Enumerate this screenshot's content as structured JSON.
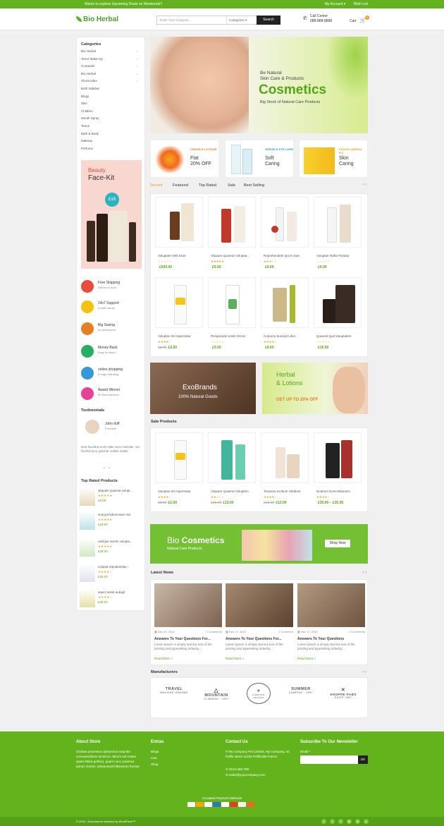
{
  "topbar": {
    "promo": "Wants to explore Upcoming Deals on Weekends?",
    "account": "My Account ▾",
    "wishlist": "Wish List"
  },
  "header": {
    "logo": "Bio Herbal",
    "search_placeholder": "Enter Your Keyword...",
    "search_category": "Categories",
    "search_button": "Search",
    "call_label": "Call Center",
    "call_number": "088-888-8888",
    "cart_label": "Cart",
    "cart_count": "0"
  },
  "sidebar": {
    "categories_title": "Categories",
    "categories": [
      {
        "label": "Bio Herbal",
        "arrow": "›"
      },
      {
        "label": "TenAl Make-Up",
        "arrow": "›"
      },
      {
        "label": "Computer",
        "arrow": "›"
      },
      {
        "label": "Bio Herbal",
        "arrow": "›"
      },
      {
        "label": "Shortcodes",
        "arrow": "›"
      },
      {
        "label": "Both Sidebar",
        "arrow": ""
      },
      {
        "label": "Blogs",
        "arrow": ""
      },
      {
        "label": "Skin",
        "arrow": ""
      },
      {
        "label": "Children",
        "arrow": ""
      },
      {
        "label": "Mouth Spray",
        "arrow": ""
      },
      {
        "label": "Teens",
        "arrow": ""
      },
      {
        "label": "Bath & Body",
        "arrow": ""
      },
      {
        "label": "Makeup",
        "arrow": ""
      },
      {
        "label": "Perfume",
        "arrow": ""
      }
    ],
    "promo_title_1": "Beauty",
    "promo_title_2": "Face-Kit",
    "promo_price": "£18",
    "services": [
      {
        "title": "Free Shipping",
        "sub": "Deliver to door",
        "color": "#e74c3c"
      },
      {
        "title": "24x7 Support",
        "sub": "in safe hands",
        "color": "#f1c40f"
      },
      {
        "title": "Big Saving",
        "sub": "at lowest price",
        "color": "#e67e22"
      },
      {
        "title": "Money Back",
        "sub": "Easy to return",
        "color": "#27ae60"
      },
      {
        "title": "online shopping",
        "sub": "A huge branding",
        "color": "#3498db"
      },
      {
        "title": "Award Winner",
        "sub": "for Best services",
        "color": "#e84393"
      }
    ],
    "testimonials_title": "Testimonials",
    "testimonial": {
      "name": "John duff",
      "role": "Producer",
      "text": "Duis faucibus enim vitae nunc molestie, nec facilisis arcu pulvinar nullam mattis."
    },
    "top_rated_title": "Top Rated Products",
    "top_rated": [
      {
        "name": "aliquam quaerat volupt...",
        "stars": "★★★★★",
        "price": "£9.00"
      },
      {
        "name": "suscipit laboriosam nisi",
        "stars": "★★★★★",
        "price": "£18.00"
      },
      {
        "name": "omlique auntin volupta...",
        "stars": "★★★★★",
        "price": "£35.00"
      },
      {
        "name": "volupta repudiandae...",
        "stars": "★★★★☆",
        "price": "£35.00"
      },
      {
        "name": "asper autoit autugit",
        "stars": "★★★★☆",
        "price": "£35.00"
      }
    ]
  },
  "hero": {
    "line1": "Be Natural",
    "line2": "Skin Care & Products",
    "title": "Cosmetics",
    "sub": "Big Stock of Natural Care Products"
  },
  "mini_banners": [
    {
      "label": "CREAM & LOTIONS",
      "l1": "Flat",
      "l2": "20% OFF",
      "lc": "#e67e22"
    },
    {
      "label": "SERUM & EYE CARE",
      "l1": "Soft",
      "l2": "Caring",
      "lc": "#2e9ec4"
    },
    {
      "label": "LEAVES HERBAL KIT",
      "l1": "Skin",
      "l2": "Caring",
      "lc": "#e6a817"
    }
  ],
  "tabs": [
    "Recent",
    "Featured",
    "Top Rated",
    "Sale",
    "Best Selling"
  ],
  "products": [
    {
      "name": "Voluptate Velit Esse",
      "stars": "☆☆☆☆☆",
      "old": "",
      "price": "£500.00"
    },
    {
      "name": "Aliquam Quaerat Voluptat...",
      "stars": "★★★★★",
      "old": "",
      "price": "£9.00"
    },
    {
      "name": "Reprehenderit Qui In Eait",
      "stars": "★★★☆☆",
      "old": "",
      "price": "£9.00"
    },
    {
      "name": "Voluptae Nullis Pariatur",
      "stars": "☆☆☆☆☆",
      "old": "",
      "price": "£9.00"
    },
    {
      "name": "Voluptas Sit Aspernatur",
      "stars": "★★★★☆",
      "old": "£3.00",
      "price": "£2.00"
    },
    {
      "name": "Perspiciatis Unde Omnis",
      "stars": "☆☆☆☆☆",
      "old": "",
      "price": "£3.00"
    },
    {
      "name": "Corporis Suscipit Libor",
      "stars": "★★★★☆",
      "old": "",
      "price": "£9.00"
    },
    {
      "name": "Quaerat Quit Voluptatem",
      "stars": "☆☆☆☆☆",
      "old": "",
      "price": "£16.00"
    }
  ],
  "banners": {
    "exo_title": "ExoBrands",
    "exo_sub": "100% Natural Goods",
    "herbal_1": "Herbal",
    "herbal_2": "& Lotions",
    "herbal_offer": "GET UP TO 20% OFF"
  },
  "sale": {
    "title": "Sale Products",
    "items": [
      {
        "name": "Voluptas Sit Aspernatur",
        "stars": "★★★★☆",
        "old": "£3.00",
        "price": "£2.00"
      },
      {
        "name": "Aliquam Quaerat Voluptem",
        "stars": "★★☆☆☆",
        "old": "£15.00",
        "price": "£12.00"
      },
      {
        "name": "Tempora Incidunt Utlabore",
        "stars": "★★★★☆",
        "old": "£15.00",
        "price": "£12.00"
      },
      {
        "name": "Nostrum Exercitationem",
        "stars": "★★★★☆",
        "old": "",
        "price": "£30.00 – £35.00"
      }
    ]
  },
  "bio": {
    "title_a": "Bio",
    "title_b": "Cosmetics",
    "sub": "Natural Care Products",
    "button": "Shop Now"
  },
  "news": {
    "title": "Latest News",
    "items": [
      {
        "date": "Dec 26, 2015",
        "comments": "0 Comments",
        "title": "Answers To Your Questions For...",
        "body": "Lorem Ipsum is simply dummy text of the printing and typesetting industry...",
        "more": "Read More »",
        "c1": "#c9b8a6",
        "c2": "#7d6150"
      },
      {
        "date": "Nov 17, 2015",
        "comments": "1 Comment",
        "title": "Answers To Your Questions For...",
        "body": "Lorem Ipsum is simply dummy text of the printing and typesetting industry...",
        "more": "Read More »",
        "c1": "#a58a6e",
        "c2": "#5b4231"
      },
      {
        "date": "Nov 17, 2015",
        "comments": "0 Comments",
        "title": "Answers To Your Questions",
        "body": "Lorem Ipsum is simply dummy text of the printing and typesetting industry...",
        "more": "Read More »",
        "c1": "#b59a80",
        "c2": "#6e5442"
      }
    ]
  },
  "manufacturers": {
    "title": "Manufacturers",
    "logos": [
      {
        "big": "TRAVEL",
        "small": "WALKING DREAMS"
      },
      {
        "big": "MOUNTAIN",
        "small": "CLIMBING · 1957"
      },
      {
        "big": "✕",
        "small": "CAMPING SEASON"
      },
      {
        "big": "SUMMER",
        "small": "CAMPING · 1997"
      },
      {
        "big": "SHOPPE·FABS",
        "small": "SINCE 1987"
      }
    ]
  },
  "footer": {
    "about_title": "About Store",
    "about_text": "Claritas processus dynamicus sequitur consuetudinem lectorum. Mirum est notare quam littera gothica, quam nunc putamus parum claram, anteposuerit litterarum formas humanitatis per seacula quarta decima et quinta decima.",
    "extras_title": "Extras",
    "extras": [
      "Blogs",
      "Cart",
      "Shop"
    ],
    "contact_title": "Contact Us",
    "address": "My Company Pvt Limited, My Company, 42 Puffin street 12345 Puffinville France",
    "phone": "0123-456-789",
    "email": "sales@yourcompany.com",
    "newsletter_title": "Subscribe To Our Newsletter",
    "email_label": "Email *",
    "ok": "OK",
    "payment_title": "Accepted Payment Methods",
    "copyright": "© 2016 - Ecommerce software by WordPress™"
  },
  "colors": {
    "brand": "#64b21f",
    "accent": "#f29b1d",
    "price": "#56a518"
  }
}
